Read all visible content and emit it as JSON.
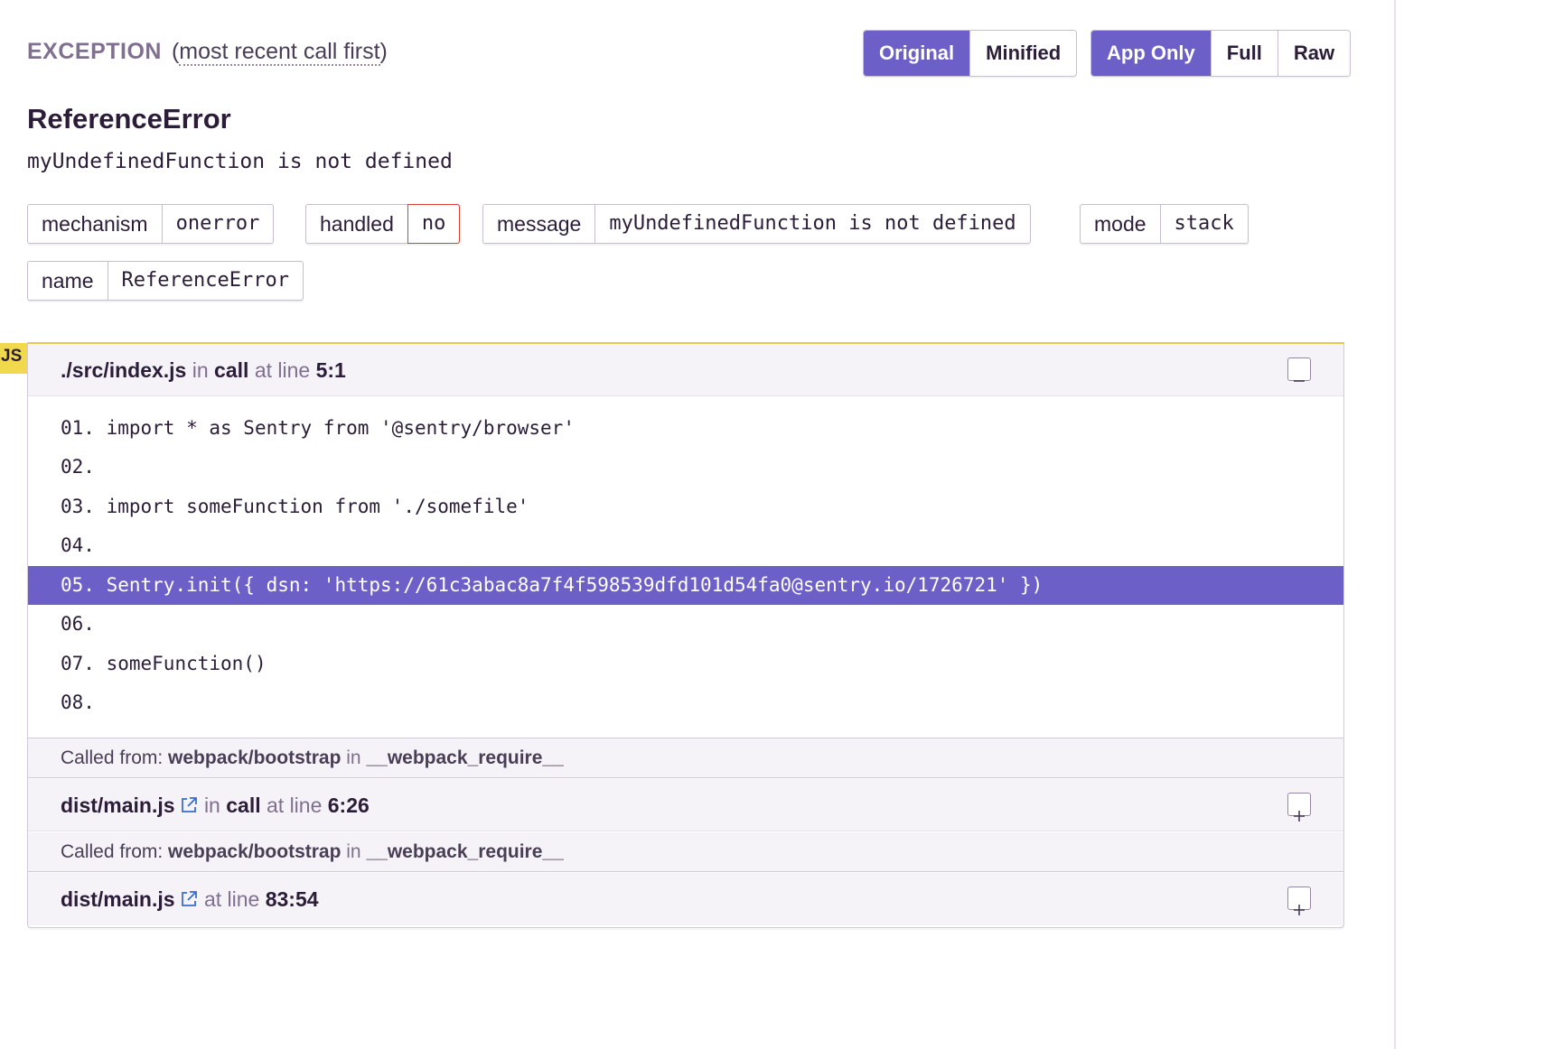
{
  "header": {
    "label": "EXCEPTION",
    "subtitle_open": "(",
    "subtitle": "most recent call first",
    "subtitle_close": ")"
  },
  "view_buttons": {
    "original": "Original",
    "minified": "Minified"
  },
  "scope_buttons": {
    "app_only": "App Only",
    "full": "Full",
    "raw": "Raw"
  },
  "exception": {
    "type": "ReferenceError",
    "value": "myUndefinedFunction is not defined"
  },
  "tags": [
    {
      "key": "mechanism",
      "value": "onerror"
    },
    {
      "key": "handled",
      "value": "no"
    },
    {
      "key": "message",
      "value": "myUndefinedFunction is not defined"
    },
    {
      "key": "mode",
      "value": "stack"
    },
    {
      "key": "name",
      "value": "ReferenceError"
    }
  ],
  "platform_badge": "JS",
  "frames": [
    {
      "file": "./src/index.js",
      "in": "in",
      "function": "call",
      "at_line": "at line",
      "location": "5:1",
      "expanded": true,
      "context": [
        {
          "no": "01.",
          "code": "import * as Sentry from '@sentry/browser'"
        },
        {
          "no": "02.",
          "code": ""
        },
        {
          "no": "03.",
          "code": "import someFunction from './somefile'"
        },
        {
          "no": "04.",
          "code": ""
        },
        {
          "no": "05.",
          "code": "Sentry.init({ dsn: 'https://61c3abac8a7f4f598539dfd101d54fa0@sentry.io/1726721' })",
          "active": true
        },
        {
          "no": "06.",
          "code": ""
        },
        {
          "no": "07.",
          "code": "someFunction()"
        },
        {
          "no": "08.",
          "code": ""
        }
      ]
    },
    {
      "called_from_label": "Called from:",
      "called_from_module": "webpack/bootstrap",
      "called_from_in": "in",
      "called_from_function": "__webpack_require__"
    },
    {
      "file": "dist/main.js",
      "in": "in",
      "function": "call",
      "at_line": "at line",
      "location": "6:26",
      "expanded": false
    },
    {
      "called_from_label": "Called from:",
      "called_from_module": "webpack/bootstrap",
      "called_from_in": "in",
      "called_from_function": "__webpack_require__"
    },
    {
      "file": "dist/main.js",
      "at_line": "at line",
      "location": "83:54",
      "expanded": false
    }
  ],
  "icons": {
    "collapse": "minus-icon",
    "expand": "plus-icon",
    "external_link": "external-link-icon"
  },
  "colors": {
    "accent": "#6c5fc7",
    "js_badge": "#f1d94d",
    "danger": "#e03e2f",
    "frame_header_bg": "#f5f3f7"
  }
}
